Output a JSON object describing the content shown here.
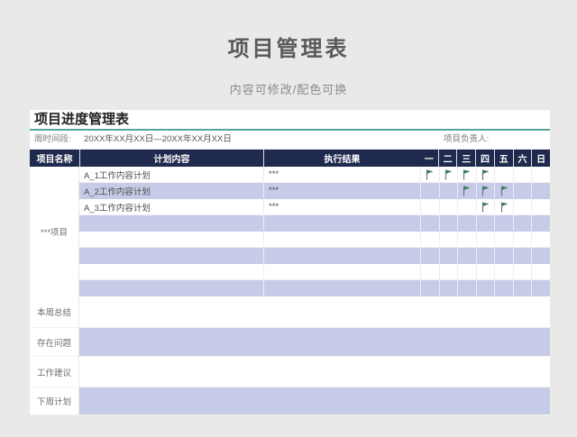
{
  "page": {
    "title": "项目管理表",
    "subtitle": "内容可修改/配色可换"
  },
  "table": {
    "section_title": "项目进度管理表",
    "info": {
      "period_label": "周时间段:",
      "period_value": "20XX年XX月XX日—20XX年XX月XX日",
      "manager_label": "项目负责人:"
    },
    "columns": [
      "项目名称",
      "计划内容",
      "执行结果"
    ],
    "day_columns": [
      "一",
      "二",
      "三",
      "四",
      "五",
      "六",
      "日"
    ],
    "project_label": "***项目",
    "rows": [
      {
        "plan": "A_1工作内容计划",
        "result": "***",
        "flags": [
          1,
          1,
          1,
          1,
          0,
          0,
          0
        ]
      },
      {
        "plan": "A_2工作内容计划",
        "result": "***",
        "flags": [
          0,
          0,
          1,
          1,
          1,
          0,
          0
        ]
      },
      {
        "plan": "A_3工作内容计划",
        "result": "***",
        "flags": [
          0,
          0,
          0,
          1,
          1,
          0,
          0
        ]
      },
      {
        "plan": "",
        "result": "",
        "flags": [
          0,
          0,
          0,
          0,
          0,
          0,
          0
        ]
      },
      {
        "plan": "",
        "result": "",
        "flags": [
          0,
          0,
          0,
          0,
          0,
          0,
          0
        ]
      },
      {
        "plan": "",
        "result": "",
        "flags": [
          0,
          0,
          0,
          0,
          0,
          0,
          0
        ]
      },
      {
        "plan": "",
        "result": "",
        "flags": [
          0,
          0,
          0,
          0,
          0,
          0,
          0
        ]
      },
      {
        "plan": "",
        "result": "",
        "flags": [
          0,
          0,
          0,
          0,
          0,
          0,
          0
        ]
      }
    ],
    "summary_rows": [
      {
        "label": "本周总结",
        "value": ""
      },
      {
        "label": "存在问题",
        "value": ""
      },
      {
        "label": "工作建议",
        "value": ""
      },
      {
        "label": "下周计划",
        "value": ""
      }
    ],
    "colors": {
      "header_bg": "#1f2a4e",
      "accent_line": "#55a4a1",
      "row_alt_bg": "#c6cce7",
      "flag_green": "#3b7d62"
    }
  }
}
